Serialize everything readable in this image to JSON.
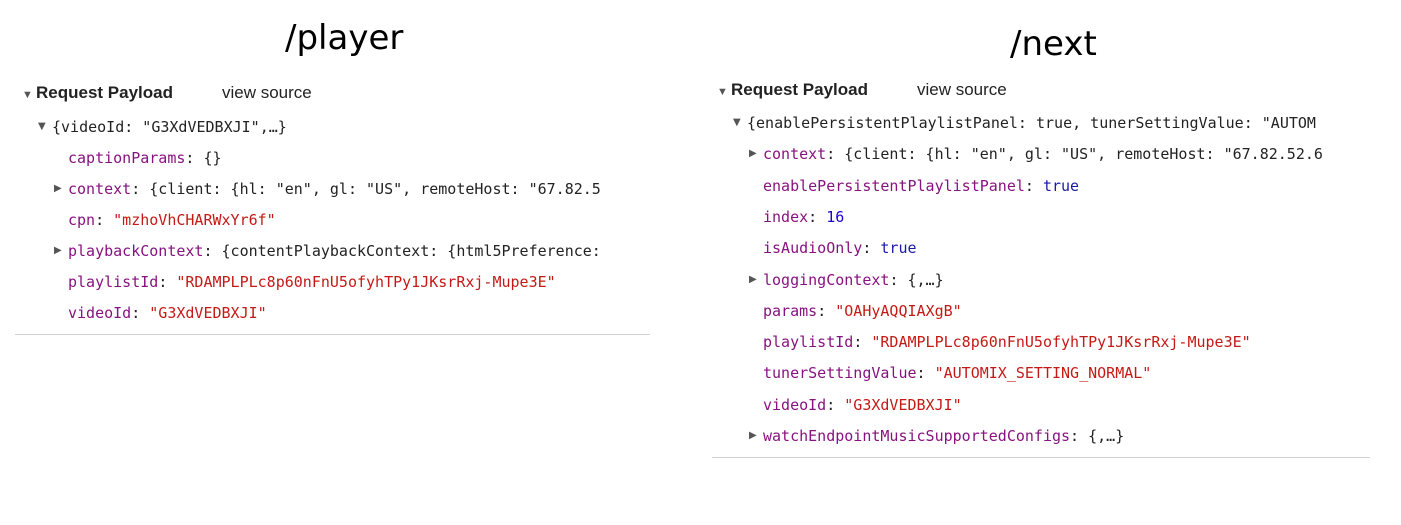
{
  "player": {
    "title": "/player",
    "header": {
      "label": "Request Payload",
      "view_source": "view source"
    },
    "rows": [
      {
        "indent": 0,
        "arrow": "down",
        "text": "{videoId: \"G3XdVEDBXJI\",…}"
      },
      {
        "indent": 1,
        "arrow": "",
        "key": "captionParams",
        "value": "{}",
        "vtype": "plain"
      },
      {
        "indent": 1,
        "arrow": "right",
        "key": "context",
        "value": "{client: {hl: \"en\", gl: \"US\", remoteHost: \"67.82.5",
        "vtype": "plain"
      },
      {
        "indent": 1,
        "arrow": "",
        "key": "cpn",
        "value": "\"mzhoVhCHARWxYr6f\"",
        "vtype": "str"
      },
      {
        "indent": 1,
        "arrow": "right",
        "key": "playbackContext",
        "value": "{contentPlaybackContext: {html5Preference:",
        "vtype": "plain"
      },
      {
        "indent": 1,
        "arrow": "",
        "key": "playlistId",
        "value": "\"RDAMPLPLc8p60nFnU5ofyhTPy1JKsrRxj-Mupe3E\"",
        "vtype": "str"
      },
      {
        "indent": 1,
        "arrow": "",
        "key": "videoId",
        "value": "\"G3XdVEDBXJI\"",
        "vtype": "str"
      }
    ]
  },
  "next": {
    "title": "/next",
    "header": {
      "label": "Request Payload",
      "view_source": "view source"
    },
    "rows": [
      {
        "indent": 0,
        "arrow": "down",
        "text": "{enablePersistentPlaylistPanel: true, tunerSettingValue: \"AUTOM"
      },
      {
        "indent": 1,
        "arrow": "right",
        "key": "context",
        "value": "{client: {hl: \"en\", gl: \"US\", remoteHost: \"67.82.52.6",
        "vtype": "plain"
      },
      {
        "indent": 1,
        "arrow": "",
        "key": "enablePersistentPlaylistPanel",
        "value": "true",
        "vtype": "kw"
      },
      {
        "indent": 1,
        "arrow": "",
        "key": "index",
        "value": "16",
        "vtype": "num"
      },
      {
        "indent": 1,
        "arrow": "",
        "key": "isAudioOnly",
        "value": "true",
        "vtype": "kw"
      },
      {
        "indent": 1,
        "arrow": "right",
        "key": "loggingContext",
        "value": "{,…}",
        "vtype": "plain"
      },
      {
        "indent": 1,
        "arrow": "",
        "key": "params",
        "value": "\"OAHyAQQIAXgB\"",
        "vtype": "str"
      },
      {
        "indent": 1,
        "arrow": "",
        "key": "playlistId",
        "value": "\"RDAMPLPLc8p60nFnU5ofyhTPy1JKsrRxj-Mupe3E\"",
        "vtype": "str"
      },
      {
        "indent": 1,
        "arrow": "",
        "key": "tunerSettingValue",
        "value": "\"AUTOMIX_SETTING_NORMAL\"",
        "vtype": "str"
      },
      {
        "indent": 1,
        "arrow": "",
        "key": "videoId",
        "value": "\"G3XdVEDBXJI\"",
        "vtype": "str"
      },
      {
        "indent": 1,
        "arrow": "right",
        "key": "watchEndpointMusicSupportedConfigs",
        "value": "{,…}",
        "vtype": "plain"
      }
    ]
  },
  "icons": {
    "expanded": "triangle-down-icon",
    "collapsed": "triangle-right-icon"
  }
}
